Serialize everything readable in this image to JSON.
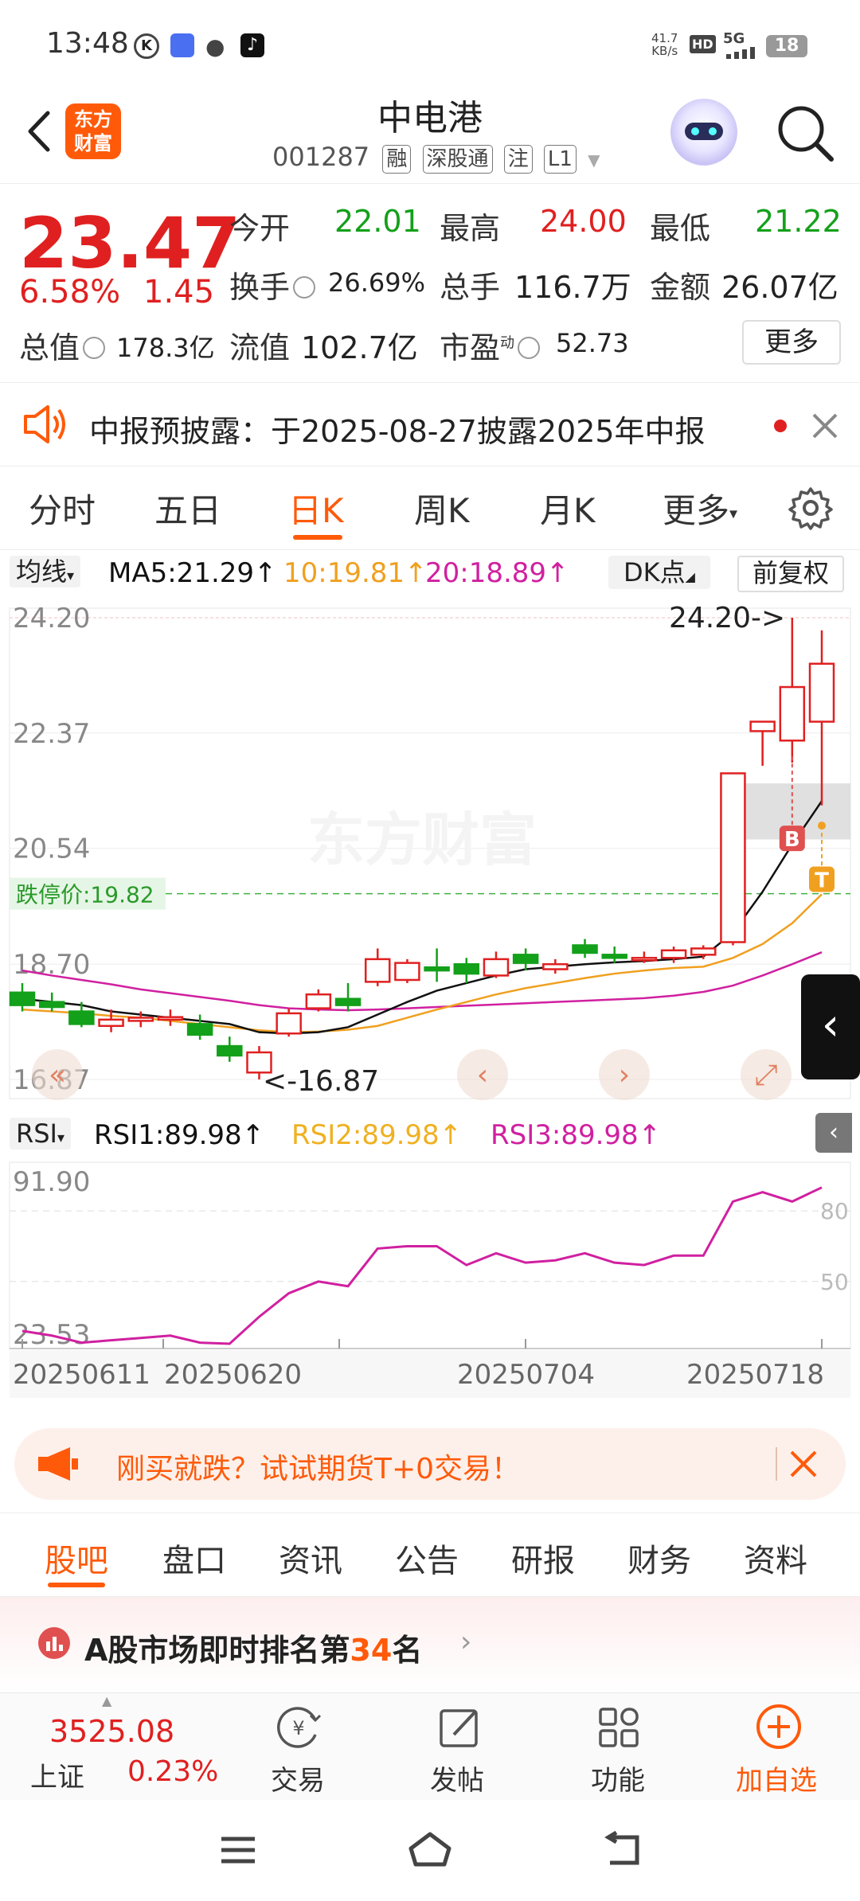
{
  "status_bar": {
    "time": "13:48",
    "net_speed": "41.7",
    "net_unit": "KB/s",
    "hd": "HD",
    "signal": "5G",
    "battery": "18"
  },
  "header": {
    "logo_line1": "东方",
    "logo_line2": "财富",
    "title": "中电港",
    "code": "001287",
    "tags": [
      "融",
      "深股通",
      "注",
      "L1"
    ]
  },
  "quote": {
    "price": "23.47",
    "change_pct": "6.58%",
    "change": "1.45",
    "open_label": "今开",
    "open": "22.01",
    "high_label": "最高",
    "high": "24.00",
    "low_label": "最低",
    "low": "21.22",
    "turnover_label": "换手",
    "turnover": "26.69%",
    "volume_label": "总手",
    "volume": "116.7万",
    "amount_label": "金额",
    "amount": "26.07亿",
    "mktcap_label": "总值",
    "mktcap": "178.3亿",
    "float_label": "流值",
    "float_cap": "102.7亿",
    "pe_label": "市盈",
    "pe_sup": "动",
    "pe": "52.73",
    "more": "更多"
  },
  "notice": {
    "text": "中报预披露：于2025-08-27披露2025年中报"
  },
  "period_tabs": [
    "分时",
    "五日",
    "日K",
    "周K",
    "月K",
    "更多"
  ],
  "active_tab": "日K",
  "ma_bar": {
    "selector": "均线",
    "ma5": "MA5:21.29↑",
    "ma10": "10:19.81↑",
    "ma20": "20:18.89↑",
    "dk": "DK点",
    "fq": "前复权"
  },
  "kline": {
    "y_labels": [
      "24.20",
      "22.37",
      "20.54",
      "18.70",
      "16.87"
    ],
    "limit_down": "跌停价:19.82",
    "max_marker": "24.20->",
    "min_marker": "<-16.87",
    "watermark": "东方财富",
    "b_mark": "B",
    "t_mark": "T"
  },
  "rsi_bar": {
    "selector": "RSI",
    "rsi1": "RSI1:89.98↑",
    "rsi2": "RSI2:89.98↑",
    "rsi3": "RSI3:89.98↑"
  },
  "rsi": {
    "y_top": "91.90",
    "y_bottom": "23.53",
    "ref80": "80",
    "ref50": "50"
  },
  "dates": [
    "20250611",
    "20250620",
    "20250704",
    "20250718"
  ],
  "ad": {
    "text": "刚买就跌？试试期货T+0交易！"
  },
  "nav_tabs": [
    "股吧",
    "盘口",
    "资讯",
    "公告",
    "研报",
    "财务",
    "资料"
  ],
  "rank": {
    "prefix": "A股市场即时排名第",
    "num": "34",
    "suffix": "名"
  },
  "bottom": {
    "index_value": "3525.08",
    "index_name": "上证",
    "index_change": "0.23%",
    "trade": "交易",
    "post": "发帖",
    "func": "功能",
    "add": "加自选"
  },
  "colors": {
    "up": "#e02020",
    "down": "#13a01a",
    "accent": "#ff5a0a",
    "ma5": "#111111",
    "ma10": "#f0a020",
    "ma20": "#d020a0"
  },
  "chart_data": {
    "type": "candlestick",
    "ylim": [
      16.87,
      24.2
    ],
    "candles": [
      {
        "o": 18.25,
        "c": 18.05,
        "h": 18.4,
        "l": 17.95
      },
      {
        "o": 18.1,
        "c": 18.02,
        "h": 18.25,
        "l": 17.95
      },
      {
        "o": 17.95,
        "c": 17.75,
        "h": 18.1,
        "l": 17.7
      },
      {
        "o": 17.72,
        "c": 17.82,
        "h": 17.98,
        "l": 17.62
      },
      {
        "o": 17.8,
        "c": 17.85,
        "h": 17.95,
        "l": 17.7
      },
      {
        "o": 17.82,
        "c": 17.86,
        "h": 17.98,
        "l": 17.72
      },
      {
        "o": 17.75,
        "c": 17.58,
        "h": 17.9,
        "l": 17.5
      },
      {
        "o": 17.4,
        "c": 17.25,
        "h": 17.55,
        "l": 17.15
      },
      {
        "o": 16.98,
        "c": 17.3,
        "h": 17.4,
        "l": 16.87
      },
      {
        "o": 17.6,
        "c": 17.92,
        "h": 18.0,
        "l": 17.55
      },
      {
        "o": 18.0,
        "c": 18.22,
        "h": 18.3,
        "l": 17.95
      },
      {
        "o": 18.15,
        "c": 18.05,
        "h": 18.4,
        "l": 17.95
      },
      {
        "o": 18.42,
        "c": 18.78,
        "h": 18.95,
        "l": 18.35
      },
      {
        "o": 18.45,
        "c": 18.72,
        "h": 18.78,
        "l": 18.4
      },
      {
        "o": 18.65,
        "c": 18.6,
        "h": 18.95,
        "l": 18.42
      },
      {
        "o": 18.7,
        "c": 18.55,
        "h": 18.8,
        "l": 18.4
      },
      {
        "o": 18.52,
        "c": 18.78,
        "h": 18.9,
        "l": 18.48
      },
      {
        "o": 18.85,
        "c": 18.72,
        "h": 18.95,
        "l": 18.6
      },
      {
        "o": 18.62,
        "c": 18.7,
        "h": 18.78,
        "l": 18.55
      },
      {
        "o": 19.0,
        "c": 18.88,
        "h": 19.1,
        "l": 18.8
      },
      {
        "o": 18.85,
        "c": 18.8,
        "h": 18.98,
        "l": 18.72
      },
      {
        "o": 18.78,
        "c": 18.8,
        "h": 18.9,
        "l": 18.72
      },
      {
        "o": 18.8,
        "c": 18.92,
        "h": 18.98,
        "l": 18.72
      },
      {
        "o": 18.85,
        "c": 18.95,
        "h": 19.0,
        "l": 18.78
      },
      {
        "o": 19.05,
        "c": 21.73,
        "h": 21.73,
        "l": 19.0
      },
      {
        "o": 22.4,
        "c": 22.55,
        "h": 22.55,
        "l": 21.85
      },
      {
        "o": 22.25,
        "c": 23.1,
        "h": 24.2,
        "l": 21.9
      },
      {
        "o": 22.55,
        "c": 23.47,
        "h": 24.0,
        "l": 21.22
      }
    ],
    "ma5": [
      18.15,
      18.1,
      18.05,
      17.95,
      17.9,
      17.85,
      17.8,
      17.75,
      17.62,
      17.6,
      17.62,
      17.7,
      17.9,
      18.1,
      18.28,
      18.4,
      18.52,
      18.62,
      18.66,
      18.7,
      18.73,
      18.75,
      18.78,
      18.82,
      19.2,
      19.85,
      20.6,
      21.29
    ],
    "ma10": [
      17.98,
      17.95,
      17.92,
      17.88,
      17.85,
      17.8,
      17.75,
      17.7,
      17.65,
      17.62,
      17.63,
      17.66,
      17.72,
      17.85,
      17.98,
      18.1,
      18.22,
      18.32,
      18.4,
      18.48,
      18.55,
      18.6,
      18.64,
      18.66,
      18.8,
      19.02,
      19.35,
      19.81
    ],
    "ma20": [
      18.6,
      18.52,
      18.45,
      18.38,
      18.3,
      18.24,
      18.18,
      18.12,
      18.05,
      18.0,
      17.98,
      17.97,
      17.98,
      18.0,
      18.02,
      18.04,
      18.06,
      18.08,
      18.1,
      18.12,
      18.14,
      18.16,
      18.2,
      18.26,
      18.36,
      18.52,
      18.7,
      18.89
    ],
    "rsi": [
      29,
      27,
      24,
      25,
      26,
      27,
      24,
      23.53,
      35,
      45,
      50,
      48,
      64,
      65,
      65,
      57,
      62,
      58,
      59,
      62,
      58,
      57,
      61,
      61,
      84,
      88,
      84,
      89.98
    ],
    "rsi_ylim": [
      23.53,
      91.9
    ]
  }
}
